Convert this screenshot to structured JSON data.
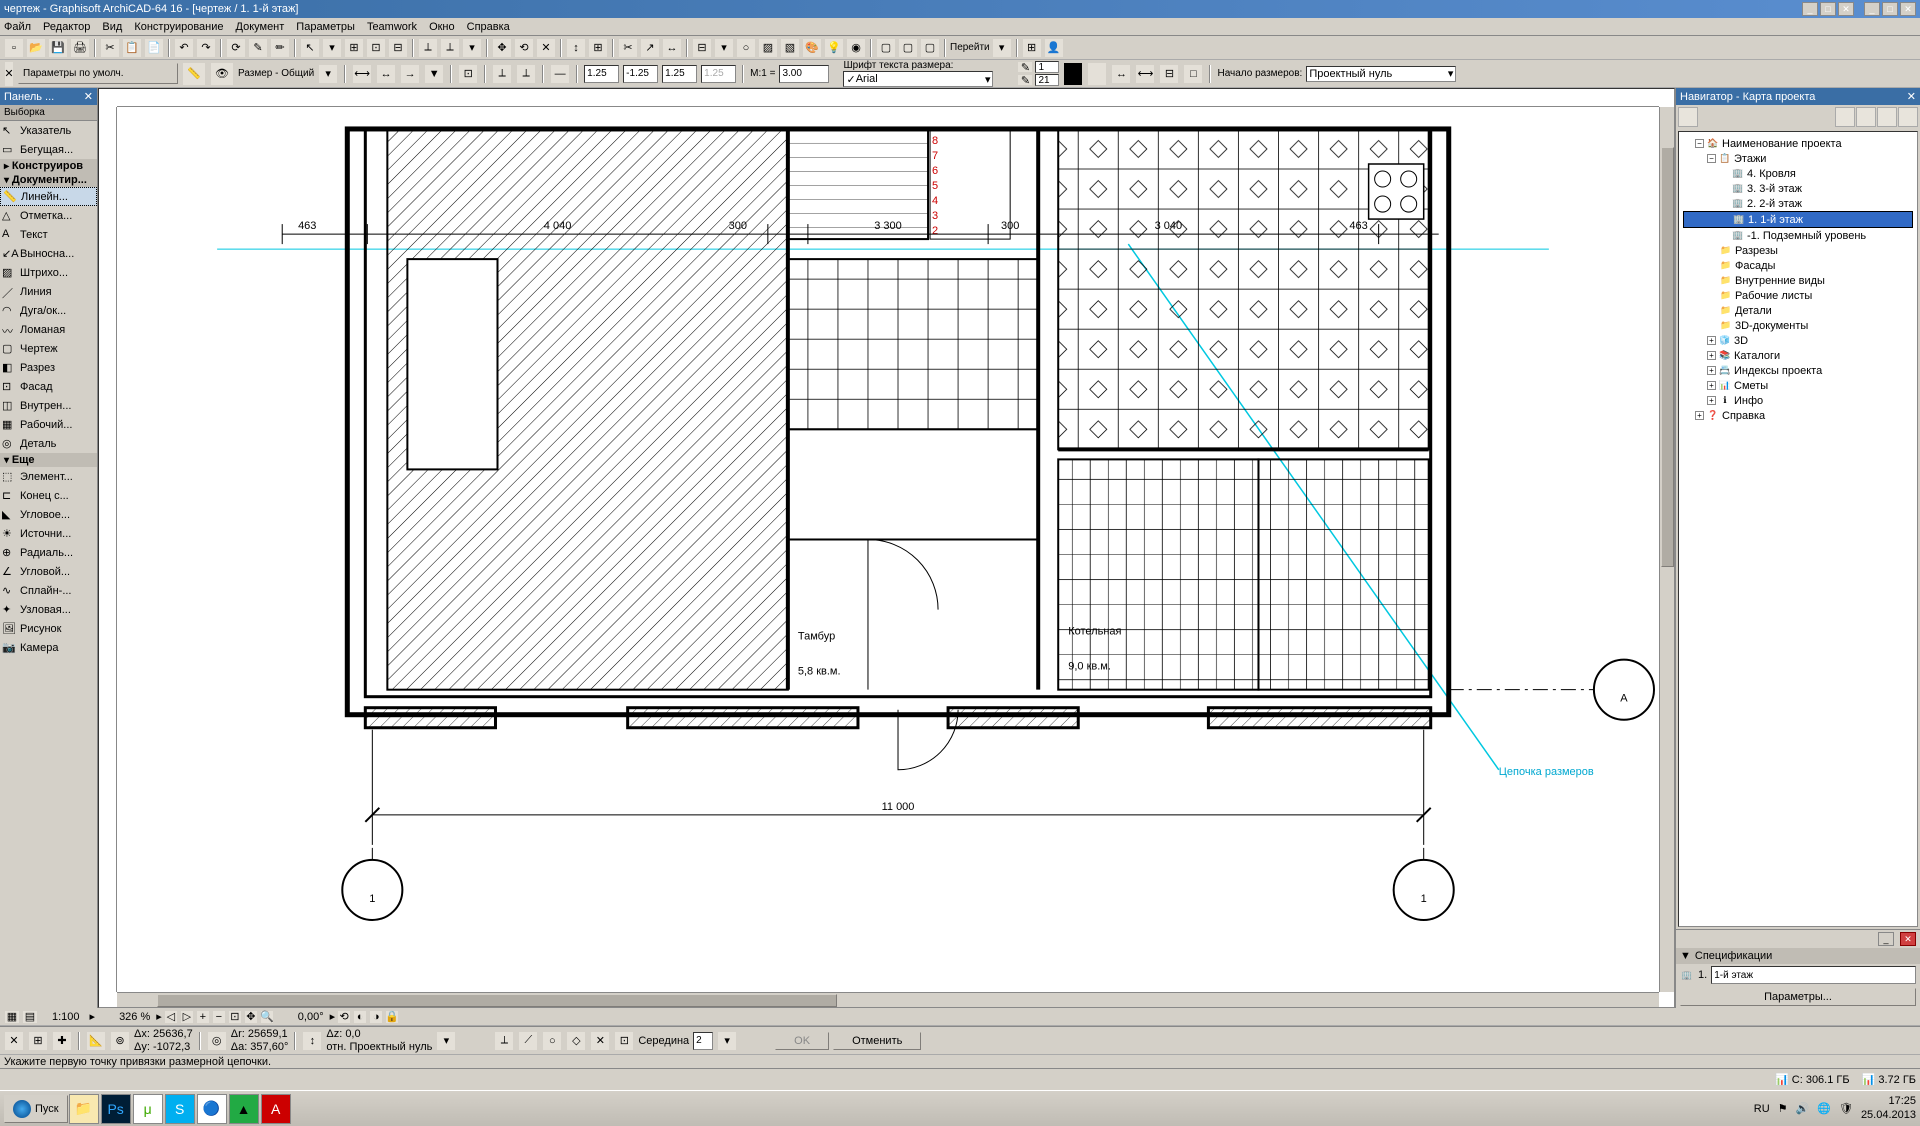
{
  "window": {
    "title": "чертеж - Graphisoft ArchiCAD-64 16 - [чертеж / 1. 1-й этаж]"
  },
  "menu": {
    "file": "Файл",
    "edit": "Редактор",
    "view": "Вид",
    "design": "Конструирование",
    "document": "Документ",
    "options": "Параметры",
    "teamwork": "Teamwork",
    "window": "Окно",
    "help": "Справка"
  },
  "toolbox": {
    "panel_title": "Панель ...",
    "selection": "Выборка",
    "pointer": "Указатель",
    "marquee": "Бегущая...",
    "construct": "Конструиров",
    "document": "Документир...",
    "dimension": "Линейн...",
    "level": "Отметка...",
    "text": "Текст",
    "leader": "Выносна...",
    "hatch": "Штрихо...",
    "line": "Линия",
    "arc": "Дуга/ок...",
    "polyline": "Ломаная",
    "drawing": "Чертеж",
    "section": "Разрез",
    "facade": "Фасад",
    "interior": "Внутрен...",
    "worksheet": "Рабочий...",
    "detail": "Деталь",
    "more": "Еще",
    "element": "Элемент...",
    "wallend": "Конец с...",
    "corner": "Угловое...",
    "light": "Источни...",
    "radial": "Радиаль...",
    "angular": "Угловой...",
    "spline": "Сплайн-...",
    "node": "Узловая...",
    "picture": "Рисунок",
    "camera": "Камера"
  },
  "info_bar": {
    "default_params": "Параметры по умолч.",
    "dimension_common": "Размер - Общий",
    "font_label": "Шрифт текста размера:",
    "font_value": "Arial",
    "scale_label": "М:1 =",
    "scale_value": "3.00",
    "text1_value": "1.25",
    "text2_value": "-1.25",
    "text3_value": "1.25",
    "text4_value": "1.25",
    "origin_label": "Начало размеров:",
    "origin_value": "Проектный нуль",
    "pen1_value": "1",
    "pen2_value": "21",
    "goto": "Перейти"
  },
  "navigator": {
    "title": "Навигатор - Карта проекта",
    "root": "Наименование проекта",
    "stories": "Этажи",
    "story4": "4. Кровля",
    "story3": "3. 3-й этаж",
    "story2": "2. 2-й этаж",
    "story1": "1. 1-й этаж",
    "story_minus1": "-1. Подземный уровень",
    "sections": "Разрезы",
    "facades": "Фасады",
    "interior_views": "Внутренние виды",
    "worksheets": "Рабочие листы",
    "details": "Детали",
    "docs3d": "3D-документы",
    "view3d": "3D",
    "catalogues": "Каталоги",
    "indexes": "Индексы проекта",
    "estimates": "Сметы",
    "info": "Инфо",
    "help": "Справка",
    "panel_below": "Спецификации",
    "selected_index": "1.",
    "selected_name": "1-й этаж",
    "params_btn": "Параметры..."
  },
  "drawing": {
    "dim_463a": "463",
    "dim_4040": "4 040",
    "dim_300a": "300",
    "dim_3300": "3 300",
    "dim_300b": "300",
    "dim_3040": "3 040",
    "dim_463b": "463",
    "dim_11000": "11 000",
    "room1_name": "Тамбур",
    "room1_area": "5,8 кв.м.",
    "room2_name": "Котельная",
    "room2_area": "9,0 кв.м.",
    "axis_a": "А",
    "axis_1a": "1",
    "axis_1b": "1",
    "annotation": "Цепочка размеров"
  },
  "bottom_nav": {
    "scale": "1:100",
    "zoom": "326 %",
    "angle": "0,00°"
  },
  "coords": {
    "dx": "Δx: 25636,7",
    "dy": "Δy: -1072,3",
    "dr": "Δr: 25659,1",
    "da": "Δa: 357,60°",
    "dz": "Δz: 0,0",
    "ref": "отн. Проектный нуль",
    "snap": "Середина",
    "snap_val": "2",
    "ok_btn": "OK",
    "cancel_btn": "Отменить"
  },
  "status": {
    "disk_c": "C: 306.1 ГБ",
    "disk_b": "3.72 ГБ",
    "lang": "RU"
  },
  "prompt": {
    "text": "Укажите первую точку привязки размерной цепочки."
  },
  "taskbar": {
    "start": "Пуск",
    "time": "17:25",
    "date": "25.04.2013"
  }
}
